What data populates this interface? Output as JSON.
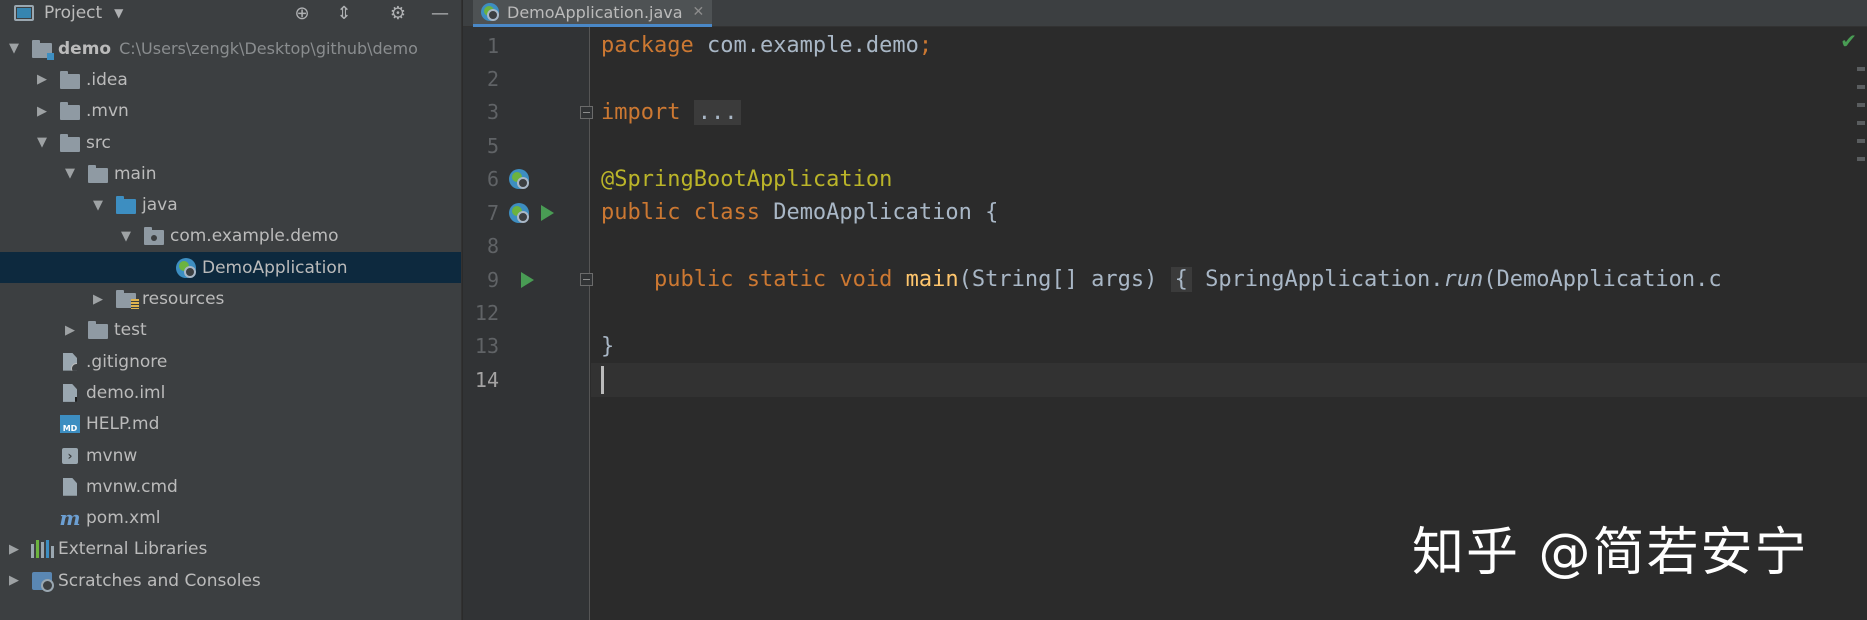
{
  "project_panel": {
    "title": "Project",
    "tree": [
      {
        "label": "demo",
        "path": "C:\\Users\\zengk\\Desktop\\github\\demo",
        "expanded": true
      },
      {
        "label": ".idea"
      },
      {
        "label": ".mvn"
      },
      {
        "label": "src"
      },
      {
        "label": "main"
      },
      {
        "label": "java"
      },
      {
        "label": "com.example.demo"
      },
      {
        "label": "DemoApplication",
        "selected": true
      },
      {
        "label": "resources"
      },
      {
        "label": "test"
      },
      {
        "label": ".gitignore"
      },
      {
        "label": "demo.iml"
      },
      {
        "label": "HELP.md"
      },
      {
        "label": "mvnw"
      },
      {
        "label": "mvnw.cmd"
      },
      {
        "label": "pom.xml"
      },
      {
        "label": "External Libraries"
      },
      {
        "label": "Scratches and Consoles"
      }
    ]
  },
  "editor": {
    "tab_label": "DemoApplication.java",
    "line_numbers": [
      "1",
      "2",
      "3",
      "5",
      "6",
      "7",
      "8",
      "9",
      "12",
      "13",
      "14"
    ],
    "code": {
      "l1_kw": "package",
      "l1_rest": " com.example.demo",
      "l1_semi": ";",
      "l3_kw": "import",
      "l3_fold": "...",
      "l6_ann": "@SpringBootApplication",
      "l7_kw": "public class",
      "l7_rest": " DemoApplication {",
      "l9_kw": "public static void",
      "l9_fn": "main",
      "l9_args": "(String[] args)",
      "l9_brace": "{",
      "l9_call": " SpringApplication.",
      "l9_run": "run",
      "l9_tail": "(DemoApplication.c",
      "l13": "}"
    }
  },
  "watermark": "知乎 @简若安宁",
  "colors": {
    "keyword": "#cc7832",
    "annotation": "#bbb529",
    "method": "#ffc66d",
    "text": "#a9b7c6",
    "selection": "#0d293e",
    "run_green": "#499c54"
  }
}
